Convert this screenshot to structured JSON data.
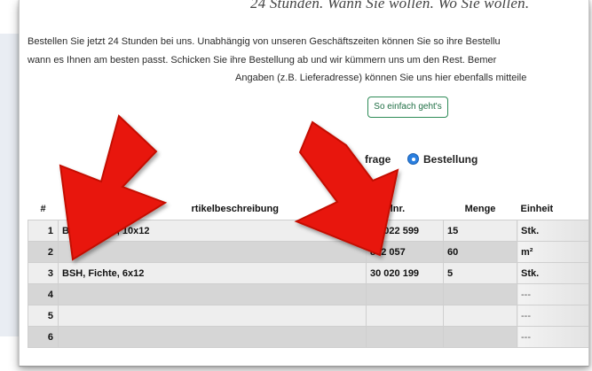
{
  "header": {
    "headline": "24 Stunden. Wann Sie wollen. Wo Sie wollen."
  },
  "intro": {
    "line1": "Bestellen Sie jetzt 24 Stunden bei uns. Unabhängig von unseren Geschäftszeiten können Sie so ihre Bestellu",
    "line2": "wann es Ihnen am besten passt. Schicken Sie ihre Bestellung ab und wir kümmern uns um den Rest. Bemer",
    "line3": "Angaben (z.B. Lieferadresse) können Sie uns hier ebenfalls mitteile"
  },
  "button": {
    "label": "So einfach geht's"
  },
  "request_type": {
    "option1": "frage",
    "option2": "Bestellung",
    "selected": "Bestellung"
  },
  "table": {
    "headers": {
      "num": "#",
      "desc": "rtikelbeschreibung",
      "art": "rtikelnr.",
      "qty": "Menge",
      "unit": "Einheit"
    },
    "rows": [
      {
        "num": "1",
        "desc": "BSH, Fichte, 10x12",
        "art": "30 022 599",
        "qty": "15",
        "unit": "Stk."
      },
      {
        "num": "2",
        "desc": "",
        "art": "802 057",
        "qty": "60",
        "unit": "m²"
      },
      {
        "num": "3",
        "desc": "BSH, Fichte, 6x12",
        "art": "30 020 199",
        "qty": "5",
        "unit": "Stk."
      },
      {
        "num": "4",
        "desc": "",
        "art": "",
        "qty": "",
        "unit": "---"
      },
      {
        "num": "5",
        "desc": "",
        "art": "",
        "qty": "",
        "unit": "---"
      },
      {
        "num": "6",
        "desc": "",
        "art": "",
        "qty": "",
        "unit": "---"
      }
    ]
  },
  "colors": {
    "arrow": "#e8190f",
    "button_border": "#2e8b57",
    "radio": "#2a7fe0"
  }
}
